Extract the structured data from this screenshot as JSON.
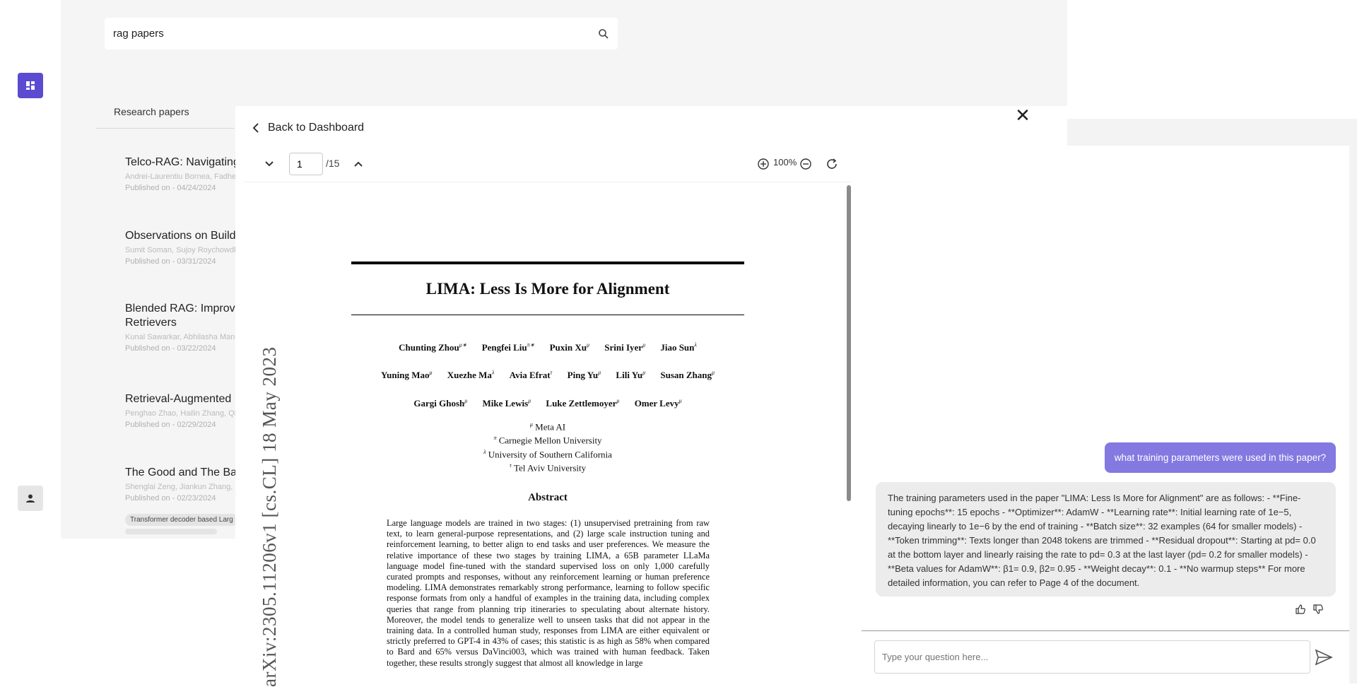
{
  "search": {
    "value": "rag papers"
  },
  "sidebar": {
    "section_label": "Research papers"
  },
  "papers": [
    {
      "title": "Telco-RAG: Navigating",
      "authors": "Andrei-Laurentiu Bornea, Fadhel",
      "date": "Published on - 04/24/2024"
    },
    {
      "title": "Observations on Build",
      "authors": "Sumit Soman, Sujoy Roychowdh",
      "date": "Published on - 03/31/2024"
    },
    {
      "title": "Blended RAG: Improvi",
      "title2": "Retrievers",
      "authors": "Kunal Sawarkar, Abhilasha Man",
      "date": "Published on - 03/22/2024"
    },
    {
      "title": "Retrieval-Augmented",
      "authors": "Penghao Zhao, Hailin Zhang, Qi",
      "date": "Published on - 02/29/2024"
    },
    {
      "title": "The Good and The Ba",
      "authors": "Shenglai Zeng, Jiankun Zhang, F",
      "date": "Published on - 02/23/2024",
      "tag": "Transformer decoder based Larg"
    }
  ],
  "modal": {
    "back_label": "Back to Dashboard",
    "close_glyph": "✕"
  },
  "pdf_toolbar": {
    "page": "1",
    "total": "/15",
    "zoom": "100%"
  },
  "pdf": {
    "title": "LIMA: Less Is More for Alignment",
    "authors_row1": [
      {
        "name": "Chunting Zhou",
        "mark": "μ∗"
      },
      {
        "name": "Pengfei Liu",
        "mark": "π∗"
      },
      {
        "name": "Puxin Xu",
        "mark": "μ"
      },
      {
        "name": "Srini Iyer",
        "mark": "μ"
      },
      {
        "name": "Jiao Sun",
        "mark": "λ"
      }
    ],
    "authors_row2": [
      {
        "name": "Yuning Mao",
        "mark": "μ"
      },
      {
        "name": "Xuezhe Ma",
        "mark": "λ"
      },
      {
        "name": "Avia Efrat",
        "mark": "τ"
      },
      {
        "name": "Ping Yu",
        "mark": "μ"
      },
      {
        "name": "Lili Yu",
        "mark": "μ"
      },
      {
        "name": "Susan Zhang",
        "mark": "μ"
      }
    ],
    "authors_row3": [
      {
        "name": "Gargi Ghosh",
        "mark": "μ"
      },
      {
        "name": "Mike Lewis",
        "mark": "μ"
      },
      {
        "name": "Luke Zettlemoyer",
        "mark": "μ"
      },
      {
        "name": "Omer Levy",
        "mark": "μ"
      }
    ],
    "affiliations": [
      {
        "mark": "μ",
        "text": "Meta AI"
      },
      {
        "mark": "π",
        "text": "Carnegie Mellon University"
      },
      {
        "mark": "λ",
        "text": "University of Southern California"
      },
      {
        "mark": "τ",
        "text": "Tel Aviv University"
      }
    ],
    "abstract_heading": "Abstract",
    "abstract": "Large language models are trained in two stages: (1) unsupervised pretraining from raw text, to learn general-purpose representations, and (2) large scale instruction tuning and reinforcement learning, to better align to end tasks and user preferences. We measure the relative importance of these two stages by training LIMA, a 65B parameter LLaMa language model fine-tuned with the standard supervised loss on only 1,000 carefully curated prompts and responses, without any reinforcement learning or human preference modeling. LIMA demonstrates remarkably strong performance, learning to follow specific response formats from only a handful of examples in the training data, including complex queries that range from planning trip itineraries to speculating about alternate history. Moreover, the model tends to generalize well to unseen tasks that did not appear in the training data. In a controlled human study, responses from LIMA are either equivalent or strictly preferred to GPT-4 in 43% of cases; this statistic is as high as 58% when compared to Bard and 65% versus DaVinci003, which was trained with human feedback. Taken together, these results strongly suggest that almost all knowledge in large",
    "arxiv_stamp": "arXiv:2305.11206v1  [cs.CL]  18 May 2023"
  },
  "chat": {
    "user_message": "what training parameters were used in this paper?",
    "bot_message": "The training parameters used in the paper \"LIMA: Less Is More for Alignment\" are as follows: - **Fine-tuning epochs**: 15 epochs - **Optimizer**: AdamW - **Learning rate**: Initial learning rate of 1e−5, decaying linearly to 1e−6 by the end of training - **Batch size**: 32 examples (64 for smaller models) - **Token trimming**: Texts longer than 2048 tokens are trimmed - **Residual dropout**: Starting at pd= 0.0 at the bottom layer and linearly raising the rate to pd= 0.3 at the last layer (pd= 0.2 for smaller models) - **Beta values for AdamW**: β1= 0.9, β2= 0.95 - **Weight decay**: 0.1 - **No warmup steps** For more detailed information, you can refer to Page 4 of the document.",
    "input_placeholder": "Type your question here..."
  },
  "colors": {
    "accent": "#5b4bd1",
    "user_bubble": "#8479e1",
    "bot_bubble": "#ececec"
  }
}
